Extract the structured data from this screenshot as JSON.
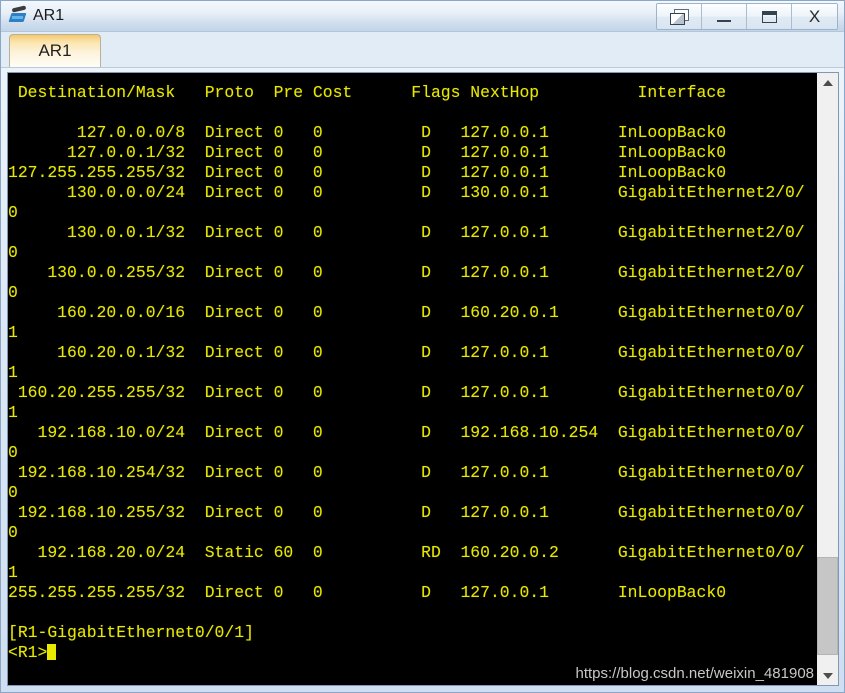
{
  "window": {
    "title": "AR1",
    "icon": "router-icon",
    "buttons": [
      {
        "name": "restore-windows-button",
        "label": "",
        "icon": "restore-windows-icon"
      },
      {
        "name": "minimize-button",
        "label": "",
        "icon": "minimize-icon"
      },
      {
        "name": "maximize-button",
        "label": "",
        "icon": "maximize-icon"
      },
      {
        "name": "close-button",
        "label": "X",
        "icon": "close-icon"
      }
    ]
  },
  "tabs": [
    {
      "label": "AR1",
      "active": true
    }
  ],
  "colors": {
    "terminal_background": "#000000",
    "terminal_text": "#e8e800",
    "titlebar_top": "#f4f8fc",
    "titlebar_bottom": "#c3d5e9",
    "tab_active_top": "#f5c96e",
    "tabstrip_background": "#e2ecf7",
    "watermark_text": "#d8d8d8",
    "scrollbar_thumb": "#c6c6c6"
  },
  "scrollbar": {
    "name": "vertical-scrollbar",
    "up_arrow": "chevron-up-icon",
    "down_arrow": "chevron-down-icon",
    "thumb_top_percent": 81,
    "thumb_height_percent": 17
  },
  "watermark": "https://blog.csdn.net/weixin_481908",
  "terminal": {
    "columns": {
      "destination_mask": "Destination/Mask",
      "proto": "Proto",
      "pre": "Pre",
      "cost": "Cost",
      "flags": "Flags",
      "nexthop": "NextHop",
      "interface": "Interface"
    },
    "routes": [
      {
        "destination": "127.0.0.0/8",
        "proto": "Direct",
        "pre": "0",
        "cost": "0",
        "flags": "D",
        "nexthop": "127.0.0.1",
        "interface": "InLoopBack0"
      },
      {
        "destination": "127.0.0.1/32",
        "proto": "Direct",
        "pre": "0",
        "cost": "0",
        "flags": "D",
        "nexthop": "127.0.0.1",
        "interface": "InLoopBack0"
      },
      {
        "destination": "127.255.255.255/32",
        "proto": "Direct",
        "pre": "0",
        "cost": "0",
        "flags": "D",
        "nexthop": "127.0.0.1",
        "interface": "InLoopBack0"
      },
      {
        "destination": "130.0.0.0/24",
        "proto": "Direct",
        "pre": "0",
        "cost": "0",
        "flags": "D",
        "nexthop": "130.0.0.1",
        "interface": "GigabitEthernet2/0/0"
      },
      {
        "destination": "130.0.0.1/32",
        "proto": "Direct",
        "pre": "0",
        "cost": "0",
        "flags": "D",
        "nexthop": "127.0.0.1",
        "interface": "GigabitEthernet2/0/0"
      },
      {
        "destination": "130.0.0.255/32",
        "proto": "Direct",
        "pre": "0",
        "cost": "0",
        "flags": "D",
        "nexthop": "127.0.0.1",
        "interface": "GigabitEthernet2/0/0"
      },
      {
        "destination": "160.20.0.0/16",
        "proto": "Direct",
        "pre": "0",
        "cost": "0",
        "flags": "D",
        "nexthop": "160.20.0.1",
        "interface": "GigabitEthernet0/0/1"
      },
      {
        "destination": "160.20.0.1/32",
        "proto": "Direct",
        "pre": "0",
        "cost": "0",
        "flags": "D",
        "nexthop": "127.0.0.1",
        "interface": "GigabitEthernet0/0/1"
      },
      {
        "destination": "160.20.255.255/32",
        "proto": "Direct",
        "pre": "0",
        "cost": "0",
        "flags": "D",
        "nexthop": "127.0.0.1",
        "interface": "GigabitEthernet0/0/1"
      },
      {
        "destination": "192.168.10.0/24",
        "proto": "Direct",
        "pre": "0",
        "cost": "0",
        "flags": "D",
        "nexthop": "192.168.10.254",
        "interface": "GigabitEthernet0/0/0"
      },
      {
        "destination": "192.168.10.254/32",
        "proto": "Direct",
        "pre": "0",
        "cost": "0",
        "flags": "D",
        "nexthop": "127.0.0.1",
        "interface": "GigabitEthernet0/0/0"
      },
      {
        "destination": "192.168.10.255/32",
        "proto": "Direct",
        "pre": "0",
        "cost": "0",
        "flags": "D",
        "nexthop": "127.0.0.1",
        "interface": "GigabitEthernet0/0/0"
      },
      {
        "destination": "192.168.20.0/24",
        "proto": "Static",
        "pre": "60",
        "cost": "0",
        "flags": "RD",
        "nexthop": "160.20.0.2",
        "interface": "GigabitEthernet0/0/1"
      },
      {
        "destination": "255.255.255.255/32",
        "proto": "Direct",
        "pre": "0",
        "cost": "0",
        "flags": "D",
        "nexthop": "127.0.0.1",
        "interface": "InLoopBack0"
      }
    ],
    "prompt_lines": [
      "[R1-GigabitEthernet0/0/1]",
      "<R1>"
    ],
    "cursor_visible": true
  }
}
